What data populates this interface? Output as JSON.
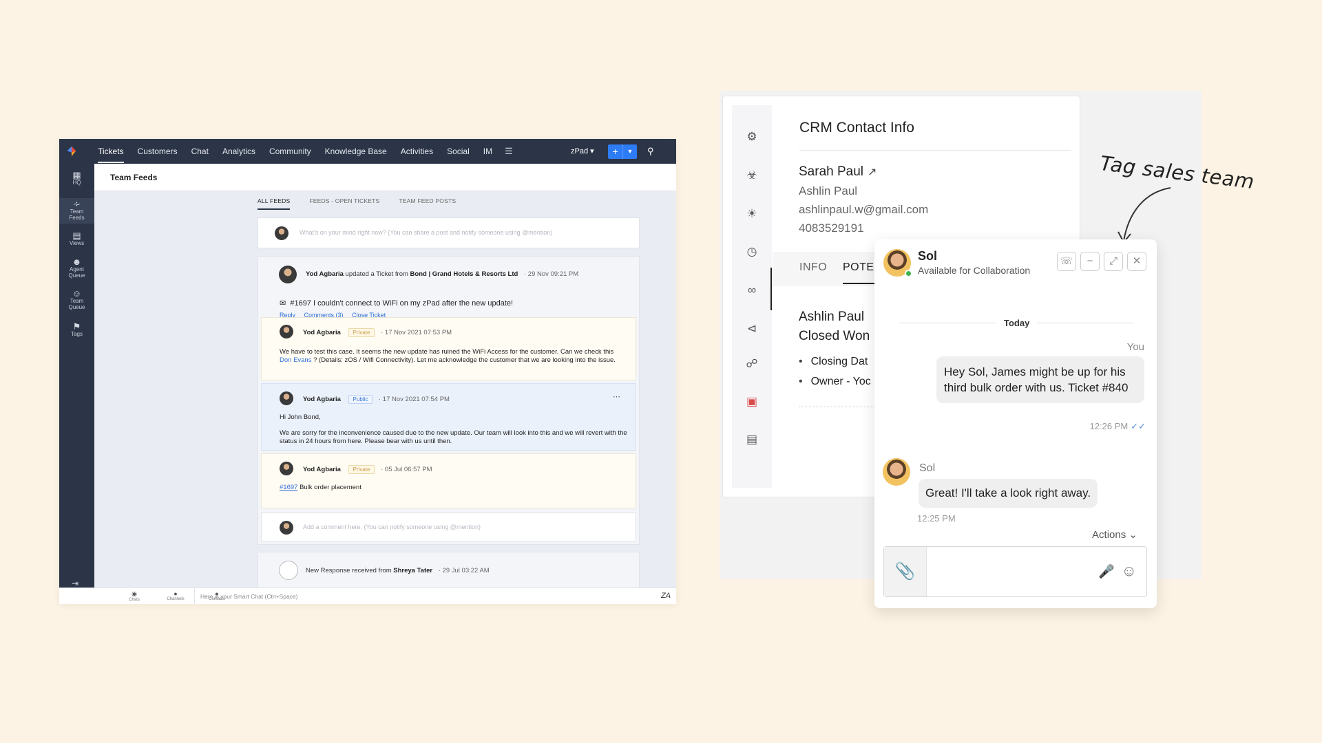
{
  "desk": {
    "nav": [
      {
        "label": "Tickets",
        "active": true
      },
      {
        "label": "Customers"
      },
      {
        "label": "Chat"
      },
      {
        "label": "Analytics"
      },
      {
        "label": "Community"
      },
      {
        "label": "Knowledge Base"
      },
      {
        "label": "Activities"
      },
      {
        "label": "Social"
      },
      {
        "label": "IM"
      }
    ],
    "workspace": "zPad",
    "add_label": "+",
    "rail": [
      {
        "label": "HQ"
      },
      {
        "label": "Team Feeds"
      },
      {
        "label": "Views"
      },
      {
        "label": "Agent Queue"
      },
      {
        "label": "Team Queue"
      },
      {
        "label": "Tags"
      }
    ],
    "page_title": "Team Feeds",
    "tabs": [
      "ALL FEEDS",
      "FEEDS - OPEN TICKETS",
      "TEAM FEED POSTS"
    ],
    "composer_placeholder": "What's on your mind right now? (You can share a post and notify someone using @mention)",
    "ticket": {
      "author": "Yod Agbaria",
      "action": "updated a Ticket from",
      "account": "Bond | Grand Hotels & Resorts Ltd",
      "time": "29 Nov 09:21 PM",
      "subject": "#1697 I couldn't connect to WiFi on my zPad after the new update!",
      "actions": [
        "Reply",
        "Comments (3)",
        "Close Ticket"
      ]
    },
    "comments": [
      {
        "author": "Yod Agbaria",
        "badge": "Private",
        "time": "17 Nov 2021 07:53 PM",
        "text_pre": "We have to test this case. It seems the new update has ruined the WiFi Access for the customer. Can we check this",
        "mention": "Don Evans",
        "text_post": "? (Details: zOS / Wifi Connectivity). Let me acknowledge the customer that we are looking into the issue."
      },
      {
        "author": "Yod Agbaria",
        "badge": "Public",
        "time": "17 Nov 2021 07:54 PM",
        "greeting": "Hi John Bond,",
        "text": "We are sorry for the inconvenience caused due to the new update. Our team will look into this and we will revert with the status in 24 hours from here. Please bear with us until then."
      },
      {
        "author": "Yod Agbaria",
        "badge": "Private",
        "time": "05 Jul 06:57 PM",
        "link": "#1697",
        "text": "Bulk order placement"
      }
    ],
    "comment_placeholder": "Add a comment here. (You can notify someone using @mention)",
    "response": {
      "text": "New Response received from",
      "author": "Shreya Tater",
      "time": "29 Jul 03:22 AM"
    },
    "smartbar": {
      "items": [
        "Chats",
        "Channels",
        "Contacts"
      ],
      "placeholder": "Here is your Smart Chat (Ctrl+Space)",
      "logo": "ZA"
    }
  },
  "crm": {
    "title": "CRM Contact Info",
    "name": "Sarah Paul",
    "alt_name": "Ashlin Paul",
    "email": "ashlinpaul.w@gmail.com",
    "phone": "4083529191",
    "tabs": [
      "INFO",
      "POTEN"
    ],
    "deal_name": "Ashlin Paul",
    "deal_stage": "Closed Won",
    "bullets": [
      "Closing Dat",
      "Owner - Yoc"
    ]
  },
  "annotation": "Tag sales team",
  "chat": {
    "name": "Sol",
    "status": "Available for Collaboration",
    "day": "Today",
    "you_label": "You",
    "out_message": "Hey Sol, James might be up for his third bulk order with us. Ticket #840",
    "out_time": "12:26 PM",
    "in_sender": "Sol",
    "in_message": "Great! I'll take a look right away.",
    "in_time": "12:25 PM",
    "actions_label": "Actions"
  },
  "colors": {
    "background": "#fdf3e4",
    "desk_nav": "#2c3547",
    "accent_blue": "#2d7cf6",
    "private_badge": "#c9a14f",
    "public_badge": "#3f7ad8",
    "online": "#3cb54a"
  }
}
